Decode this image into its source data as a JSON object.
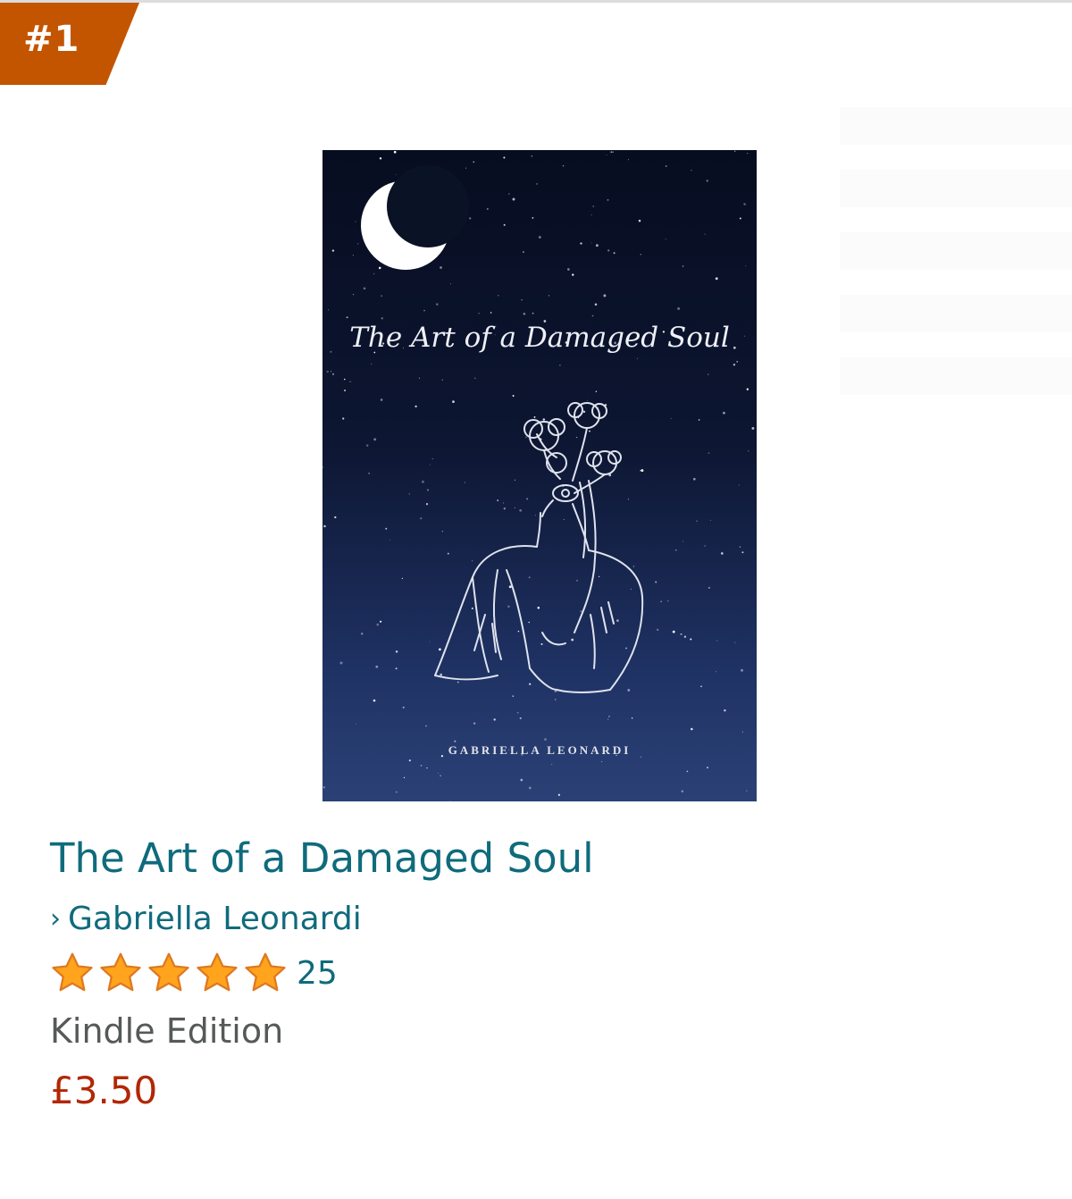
{
  "rank": "#1",
  "cover": {
    "title": "The Art of a Damaged Soul",
    "author": "GABRIELLA LEONARDI"
  },
  "product": {
    "title": "The Art of a Damaged Soul",
    "author": "Gabriella Leonardi",
    "rating_stars": 5,
    "rating_count": "25",
    "format": "Kindle Edition",
    "price": "£3.50"
  },
  "colors": {
    "badge": "#c45500",
    "link": "#0f6b7c",
    "price": "#b12704",
    "star": "#ffa41c"
  }
}
